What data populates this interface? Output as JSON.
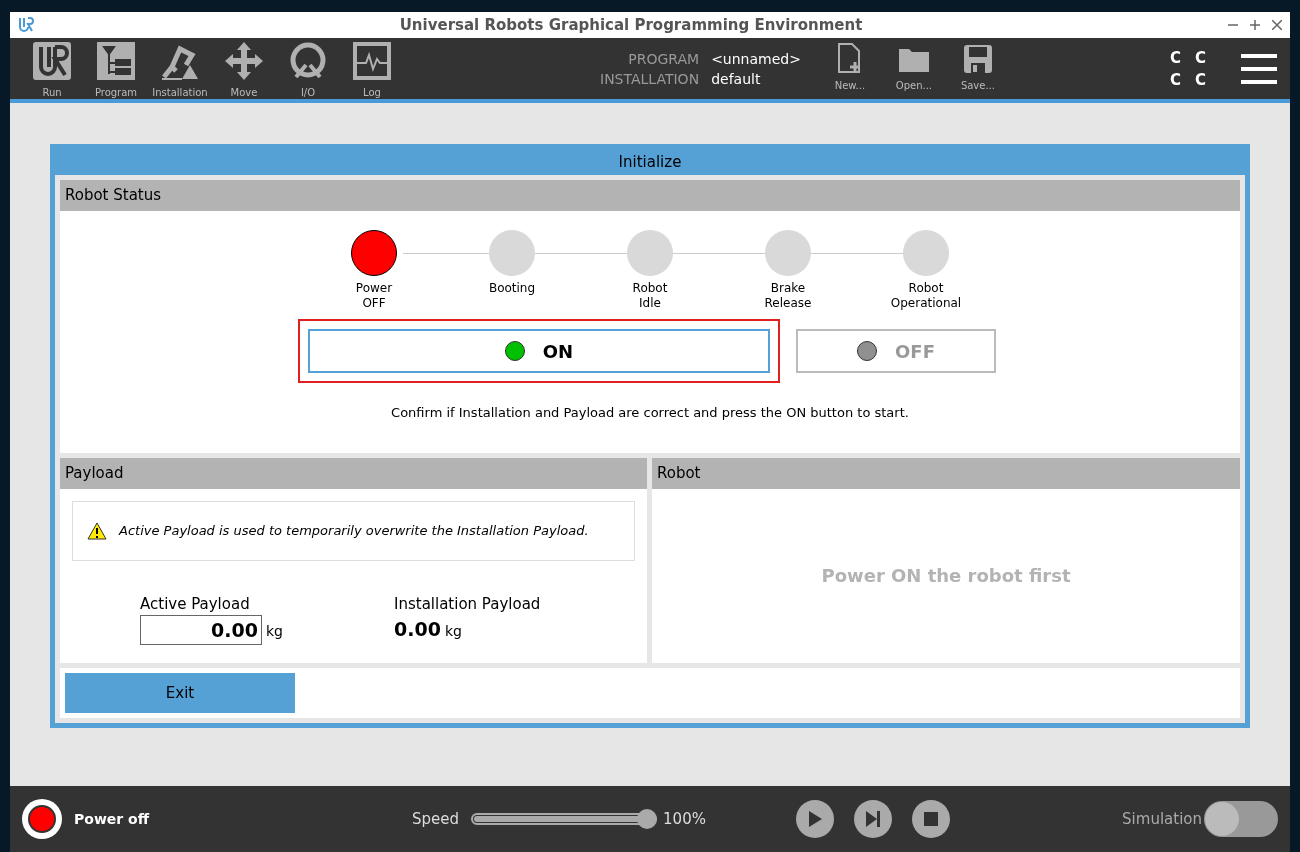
{
  "window": {
    "title": "Universal Robots Graphical Programming Environment"
  },
  "toolbar": {
    "tools": [
      {
        "label": "Run",
        "kind": "logo"
      },
      {
        "label": "Program",
        "kind": "tree"
      },
      {
        "label": "Installation",
        "kind": "arm"
      },
      {
        "label": "Move",
        "kind": "move"
      },
      {
        "label": "I/O",
        "kind": "io"
      },
      {
        "label": "Log",
        "kind": "log"
      }
    ],
    "program_label": "PROGRAM",
    "program_value": "<unnamed>",
    "installation_label": "INSTALLATION",
    "installation_value": "default",
    "files": [
      {
        "label": "New...",
        "kind": "new"
      },
      {
        "label": "Open...",
        "kind": "open"
      },
      {
        "label": "Save...",
        "kind": "save"
      }
    ],
    "cc": [
      "C",
      "C",
      "C",
      "C"
    ]
  },
  "dialog": {
    "title": "Initialize",
    "robot_status": {
      "title": "Robot Status",
      "steps": [
        {
          "label": "Power\nOFF",
          "active": true
        },
        {
          "label": "Booting",
          "active": false
        },
        {
          "label": "Robot\nIdle",
          "active": false
        },
        {
          "label": "Brake\nRelease",
          "active": false
        },
        {
          "label": "Robot\nOperational",
          "active": false
        }
      ],
      "buttons": [
        {
          "label": "ON",
          "disabled": false,
          "focused": true,
          "color": "#00c000"
        },
        {
          "label": "OFF",
          "disabled": true,
          "focused": false,
          "color": "#909090"
        }
      ],
      "message": "Confirm if Installation and Payload are correct and press the ON button to start."
    },
    "payload": {
      "title": "Payload",
      "warning": "Active Payload is used to temporarily overwrite the Installation Payload.",
      "active_label": "Active Payload",
      "active_value": "0.00",
      "active_unit": "kg",
      "installation_label": "Installation Payload",
      "installation_value": "0.00",
      "installation_unit": "kg"
    },
    "robot": {
      "title": "Robot",
      "message": "Power ON the robot first"
    },
    "exit": "Exit"
  },
  "status_bar": {
    "power": "Power off",
    "power_on": false,
    "speed_label": "Speed",
    "speed": {
      "level": 1.0
    },
    "speed_reading": "100%",
    "simulation_label": "Simulation",
    "simulation_on": false
  }
}
